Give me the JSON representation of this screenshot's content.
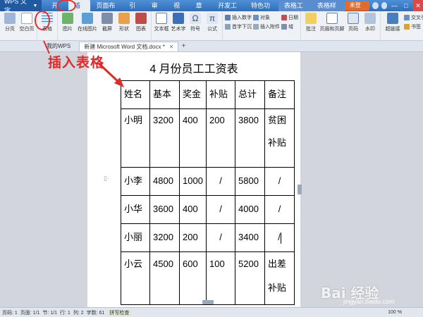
{
  "app": {
    "logo": "WPS 文字"
  },
  "menu": [
    {
      "label": "开始"
    },
    {
      "label": "插入"
    },
    {
      "label": "页面布局"
    },
    {
      "label": "引用"
    },
    {
      "label": "审阅"
    },
    {
      "label": "视图"
    },
    {
      "label": "章节"
    },
    {
      "label": "开发工具"
    },
    {
      "label": "特色功能"
    },
    {
      "label": "表格工具"
    },
    {
      "label": "表格样式"
    }
  ],
  "login_label": "未登录",
  "ribbon": {
    "page_break": "分页",
    "blank_page": "空白页",
    "table": "表格",
    "picture": "图片",
    "online_picture": "在线图片",
    "screenshot": "截屏",
    "shapes": "形状",
    "chart": "图表",
    "textbox": "文本框",
    "wordart": "艺术字",
    "symbol": "符号",
    "formula": "公式",
    "insert_number": "插入数字",
    "object": "对象",
    "date": "日期",
    "first_letter": "首字下沉",
    "attachment": "插入附件",
    "field": "域",
    "comment": "批注",
    "header_footer": "页眉和页脚",
    "page_number": "页码",
    "watermark": "水印",
    "hyperlink": "超链接",
    "cross_ref": "交叉引用",
    "bookmark": "书签"
  },
  "tabs": {
    "home": "我的WPS",
    "doc": "新建 Microsoft Word 文档.docx *"
  },
  "annotation": "插入表格",
  "document": {
    "title": "4 月份员工工资表",
    "headers": [
      "姓名",
      "基本",
      "奖金",
      "补贴",
      "总计",
      "备注"
    ],
    "rows": [
      [
        "小明",
        "3200",
        "400",
        "200",
        "3800",
        "贫困",
        "补贴"
      ],
      [
        "小李",
        "4800",
        "1000",
        "/",
        "5800",
        "/"
      ],
      [
        "小华",
        "3600",
        "400",
        "/",
        "4000",
        "/"
      ],
      [
        "小丽",
        "3200",
        "200",
        "/",
        "3400",
        "/"
      ],
      [
        "小云",
        "4500",
        "600",
        "100",
        "5200",
        "出差",
        "补贴"
      ]
    ]
  },
  "status": {
    "page_num": "页码: 1",
    "page": "页面: 1/1",
    "section": "节: 1/1",
    "row": "行: 1",
    "col": "列: 2",
    "words": "字数: 61",
    "spell": "拼写检查",
    "zoom": "100 %"
  },
  "watermark": {
    "brand": "Bai 经验",
    "url": "jingyan.baidu.com"
  }
}
